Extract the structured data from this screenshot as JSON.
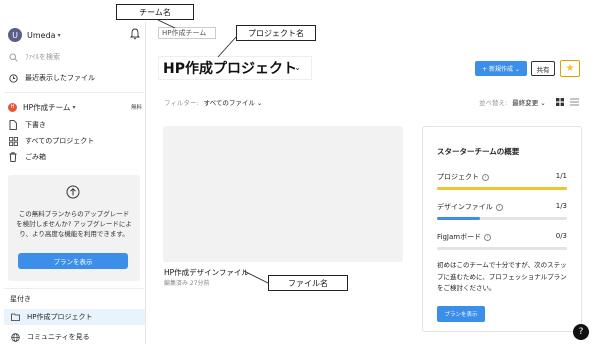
{
  "annotations": {
    "team_name": "チーム名",
    "project_name": "プロジェクト名",
    "file_name": "ファイル名"
  },
  "sidebar": {
    "user_initial": "U",
    "user_name": "Umeda",
    "search_placeholder": "ﾌｧｲﾙを検索",
    "recent_files": "最近表示したファイル",
    "team_initial": "H",
    "team_name": "HP作成チーム",
    "free_badge": "無料",
    "nav_items": [
      "下書き",
      "すべてのプロジェクト",
      "ごみ箱"
    ],
    "upgrade_text": "この無料プランからのアップグレードを検討しませんか? アップグレードにより、より高度な機能を利用できます。",
    "upgrade_button": "プランを表示",
    "starred_title": "星付き",
    "starred_item": "HP作成プロジェクト",
    "community": "コミュニティを見る"
  },
  "main": {
    "breadcrumb": "HP作成チーム",
    "project_title": "HP作成プロジェクト",
    "new_button": "+ 新規作成 ⌄",
    "share_button": "共有",
    "filter_label": "フィルター:",
    "filter_value": "すべてのファイル ⌄",
    "sort_label": "並べ替え:",
    "sort_value": "最終変更 ⌄",
    "file": {
      "name": "HP作成デザインファイル",
      "meta": "編集済み 27分前"
    }
  },
  "starter_panel": {
    "title": "スターターチームの概要",
    "rows": [
      {
        "label": "プロジェクト",
        "count": "1/1",
        "fraction": 1.0
      },
      {
        "label": "デザインファイル",
        "count": "1/3",
        "fraction": 0.333
      },
      {
        "label": "FigJamボード",
        "count": "0/3",
        "fraction": 0.0
      }
    ],
    "description": "初めはこのチームで十分ですが、次のステップに進むために、プロフェッショナルプランをご検討ください。",
    "button": "プランを表示"
  },
  "colors": {
    "accent": "#3b8fe8",
    "project_bar": "#f4c130",
    "design_bar": "#3b8fe8",
    "team_dot": "#e9543b",
    "star": "#f4c130"
  },
  "help": "?"
}
